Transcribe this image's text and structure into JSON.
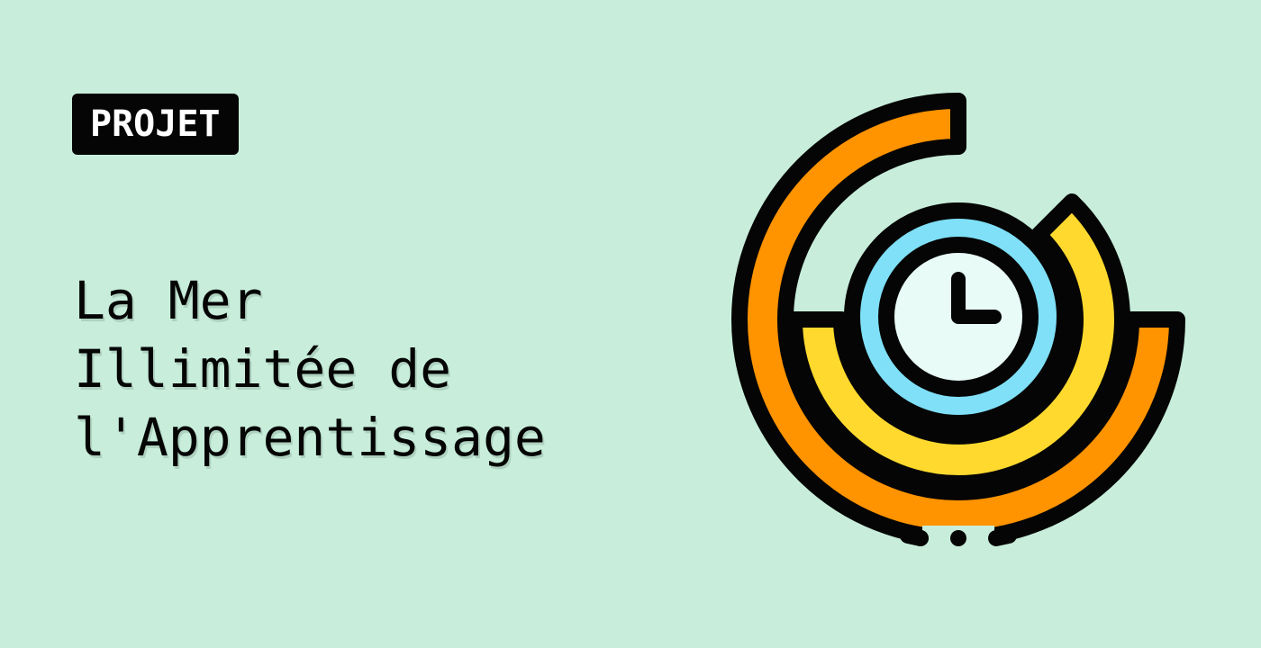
{
  "badge": {
    "label": "PROJET"
  },
  "title": {
    "lines": [
      "La Mer",
      "Illimitée de",
      "l'Apprentissage"
    ]
  },
  "illustration": {
    "icon": "clock-radial-chart-icon",
    "colors": {
      "background": "#c8eedb",
      "outer_ring": "#ff9300",
      "middle_ring": "#ffd92e",
      "inner_ring": "#7fe0f7",
      "clock_face": "#e8fbf7",
      "outline": "#050505"
    }
  }
}
